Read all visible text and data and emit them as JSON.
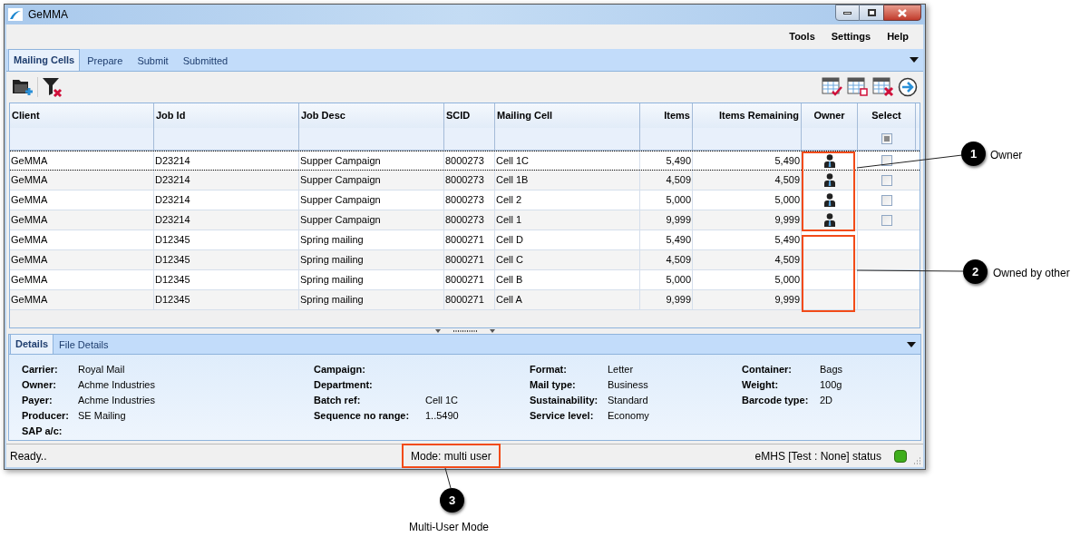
{
  "window": {
    "title": "GeMMA"
  },
  "menu": [
    "Tools",
    "Settings",
    "Help"
  ],
  "tabs": [
    {
      "label": "Mailing Cells",
      "selected": true
    },
    {
      "label": "Prepare",
      "selected": false
    },
    {
      "label": "Submit",
      "selected": false
    },
    {
      "label": "Submitted",
      "selected": false
    }
  ],
  "table": {
    "columns": [
      "Client",
      "Job Id",
      "Job Desc",
      "SCID",
      "Mailing Cell",
      "Items",
      "Items Remaining",
      "Owner",
      "Select"
    ],
    "select_all": {
      "indeterminate": true
    },
    "rows": [
      {
        "cells": [
          "GeMMA",
          "D23214",
          "Supper Campaign",
          "8000273",
          "Cell 1C",
          "5,490",
          "5,490"
        ],
        "owned": true,
        "selectable": true,
        "current": true
      },
      {
        "cells": [
          "GeMMA",
          "D23214",
          "Supper Campaign",
          "8000273",
          "Cell 1B",
          "4,509",
          "4,509"
        ],
        "owned": true,
        "selectable": true,
        "current": false
      },
      {
        "cells": [
          "GeMMA",
          "D23214",
          "Supper Campaign",
          "8000273",
          "Cell 2",
          "5,000",
          "5,000"
        ],
        "owned": true,
        "selectable": true,
        "current": false
      },
      {
        "cells": [
          "GeMMA",
          "D23214",
          "Supper Campaign",
          "8000273",
          "Cell 1",
          "9,999",
          "9,999"
        ],
        "owned": true,
        "selectable": true,
        "current": false
      },
      {
        "cells": [
          "GeMMA",
          "D12345",
          "Spring mailing",
          "8000271",
          "Cell D",
          "5,490",
          "5,490"
        ],
        "owned": false,
        "selectable": false,
        "current": false
      },
      {
        "cells": [
          "GeMMA",
          "D12345",
          "Spring mailing",
          "8000271",
          "Cell C",
          "4,509",
          "4,509"
        ],
        "owned": false,
        "selectable": false,
        "current": false
      },
      {
        "cells": [
          "GeMMA",
          "D12345",
          "Spring mailing",
          "8000271",
          "Cell B",
          "5,000",
          "5,000"
        ],
        "owned": false,
        "selectable": false,
        "current": false
      },
      {
        "cells": [
          "GeMMA",
          "D12345",
          "Spring mailing",
          "8000271",
          "Cell A",
          "9,999",
          "9,999"
        ],
        "owned": false,
        "selectable": false,
        "current": false
      }
    ]
  },
  "detail_tabs": [
    {
      "label": "Details",
      "selected": true
    },
    {
      "label": "File Details",
      "selected": false
    }
  ],
  "details": [
    [
      {
        "label": "Carrier:",
        "value": "Royal Mail"
      },
      {
        "label": "Owner:",
        "value": "Achme Industries"
      },
      {
        "label": "Payer:",
        "value": "Achme Industries"
      },
      {
        "label": "Producer:",
        "value": "SE Mailing"
      },
      {
        "label": "SAP a/c:"
      }
    ],
    [
      {
        "label": "Campaign:"
      },
      {
        "label": "Department:"
      },
      {
        "label": "Batch ref:",
        "value": "Cell 1C"
      },
      {
        "label": "Sequence no range:",
        "value": "1..5490"
      }
    ],
    [
      {
        "label": "Format:",
        "value": "Letter"
      },
      {
        "label": "Mail type:",
        "value": "Business"
      },
      {
        "label": "Sustainability:",
        "value": "Standard"
      },
      {
        "label": "Service level:",
        "value": "Economy"
      }
    ],
    [
      {
        "label": "Container:",
        "value": "Bags"
      },
      {
        "label": "Weight:",
        "value": "100g"
      },
      {
        "label": "Barcode type:",
        "value": "2D"
      }
    ]
  ],
  "status_bar": {
    "message": "Ready..",
    "mode": "Mode: multi user",
    "service": "eMHS [Test : None] status"
  },
  "annotations": [
    {
      "number": "1",
      "label": "Owner"
    },
    {
      "number": "2",
      "label": "Owned by other"
    },
    {
      "number": "3",
      "label": "Multi-User Mode"
    }
  ]
}
